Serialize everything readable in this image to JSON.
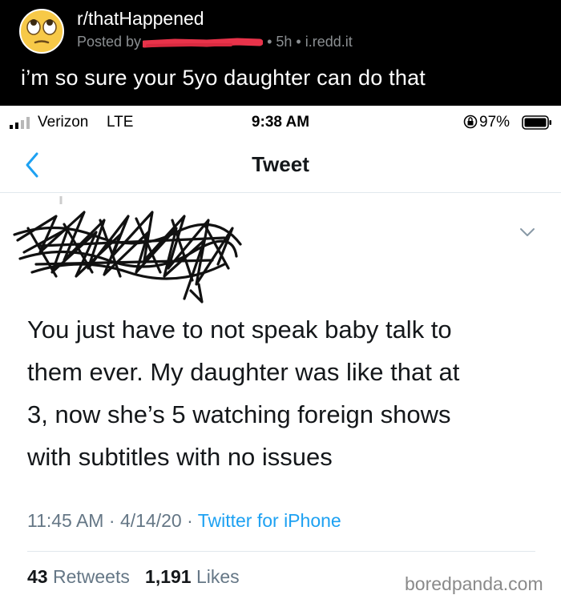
{
  "reddit": {
    "subreddit": "r/thatHappened",
    "posted_by_prefix": "Posted by",
    "age": "5h",
    "domain": "i.redd.it",
    "title": "i’m so sure your 5yo daughter can do that"
  },
  "status_bar": {
    "carrier": "Verizon",
    "network": "LTE",
    "time": "9:38 AM",
    "battery": "97%"
  },
  "nav": {
    "title": "Tweet"
  },
  "tweet": {
    "lines": [
      "You just have to not speak baby talk to",
      "them ever. My daughter was like that at",
      "3, now she’s 5 watching foreign shows",
      "with subtitles with no issues"
    ],
    "time": "11:45 AM",
    "date": "4/14/20",
    "source": "Twitter for iPhone",
    "retweets_count": "43",
    "retweets_label": "Retweets",
    "likes_count": "1,191",
    "likes_label": "Likes"
  },
  "watermark": "boredpanda.com",
  "colors": {
    "reddit_bg": "#000000",
    "twitter_blue": "#1da1f2",
    "redaction_red": "#e8334a",
    "meta_gray": "#657786"
  },
  "icons": [
    "rolling-eyes-emoji-icon",
    "signal-icon",
    "orientation-lock-icon",
    "battery-icon",
    "back-chevron-icon",
    "chevron-down-icon"
  ]
}
